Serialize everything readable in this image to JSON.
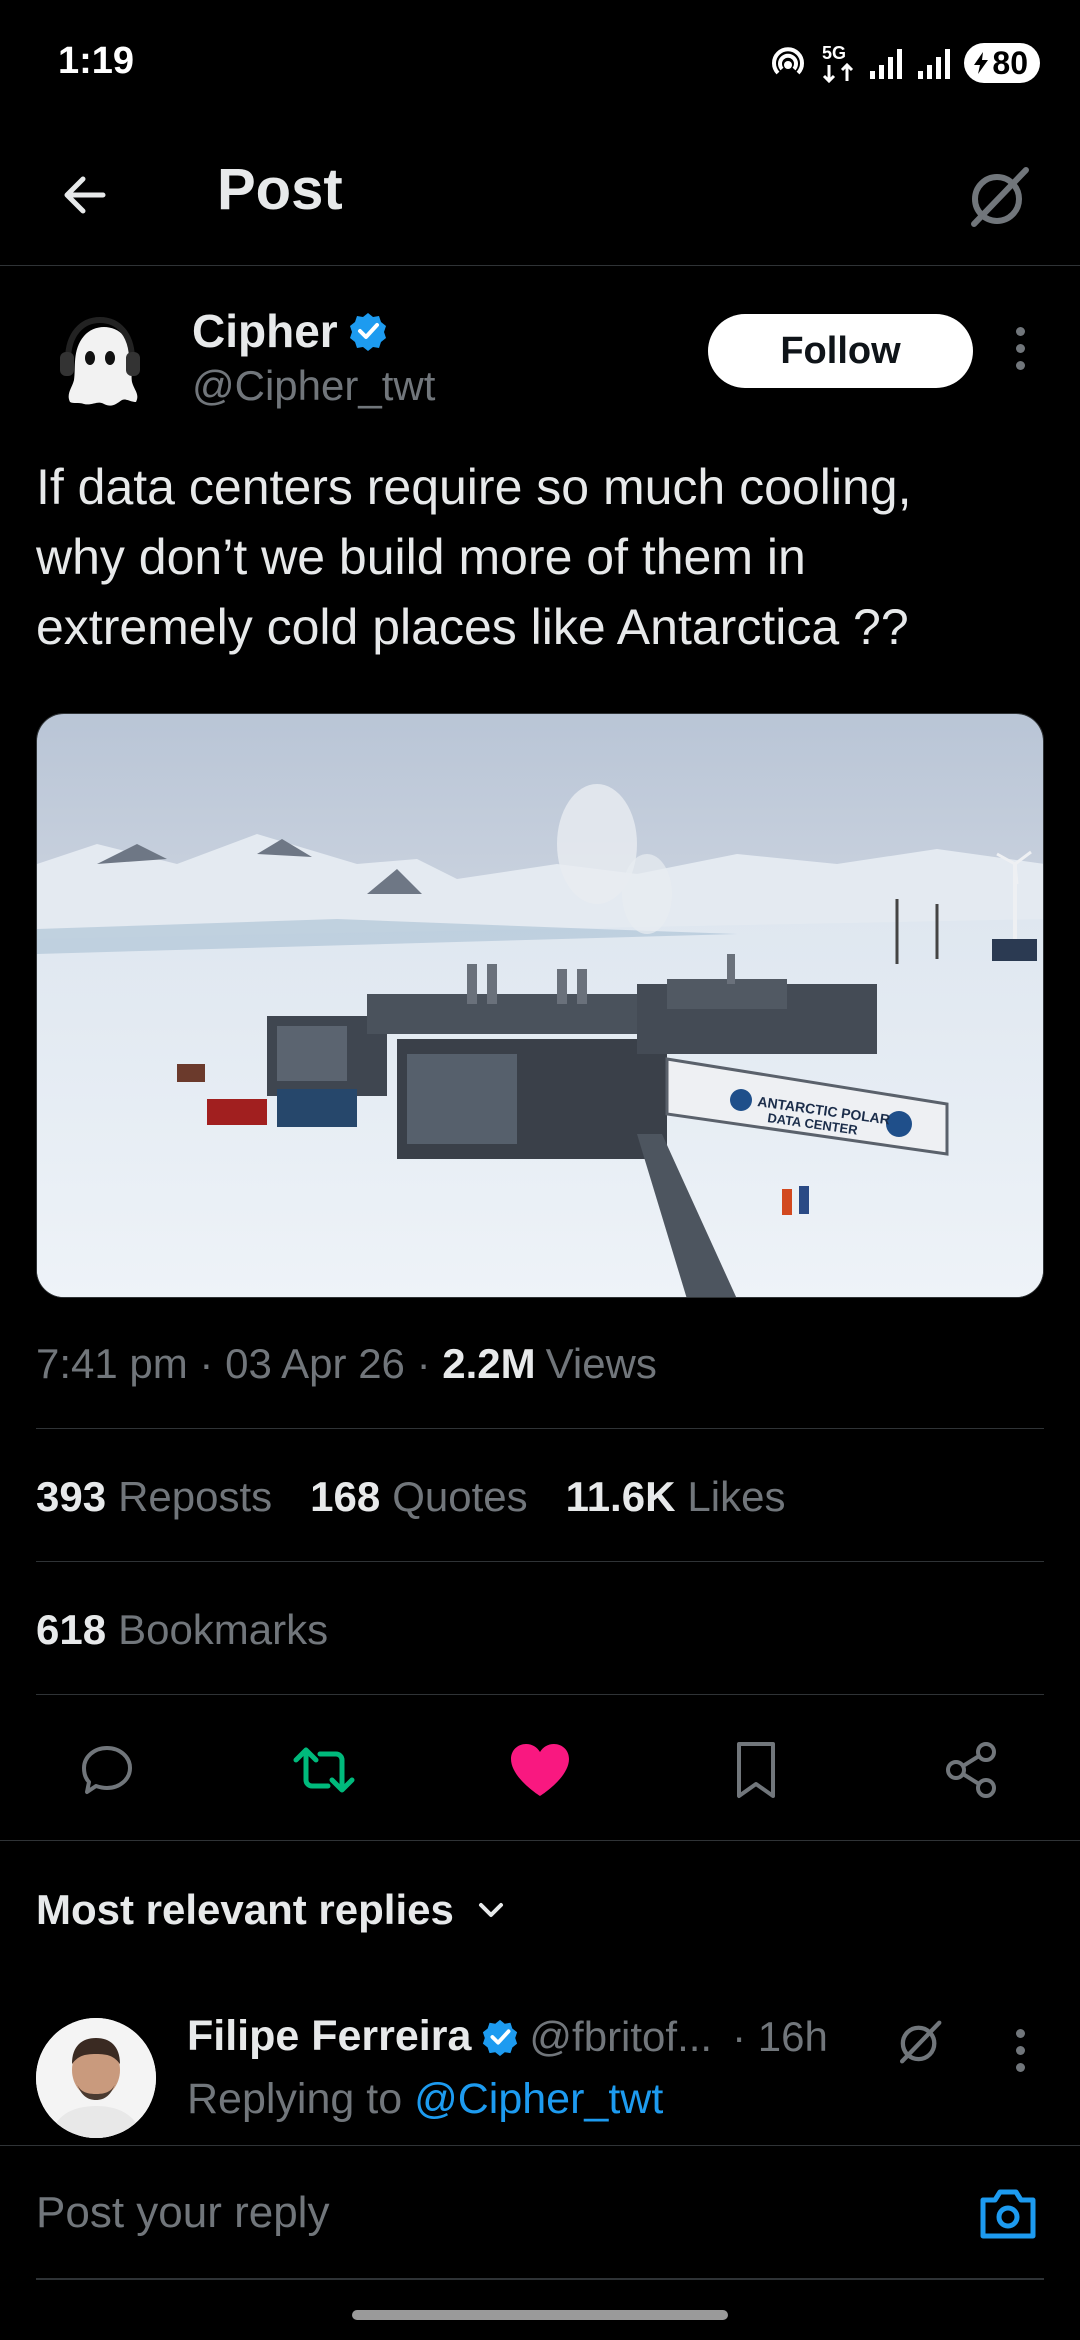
{
  "status_bar": {
    "time": "1:19",
    "network": "5G",
    "battery": "80"
  },
  "header": {
    "title": "Post"
  },
  "post": {
    "author_name": "Cipher",
    "author_handle": "@Cipher_twt",
    "follow_label": "Follow",
    "text": "If data centers require so much cooling,\nwhy don’t we build more of them in\nextremely cold places like Antarctica ??",
    "image_sign_text": [
      "ANTARCTIC POLAR",
      "DATA CENTER"
    ],
    "time": "7:41 pm",
    "date": "03 Apr 26",
    "views_count": "2.2M",
    "views_label": "Views",
    "reposts_count": "393",
    "reposts_label": "Reposts",
    "quotes_count": "168",
    "quotes_label": "Quotes",
    "likes_count": "11.6K",
    "likes_label": "Likes",
    "bookmarks_count": "618",
    "bookmarks_label": "Bookmarks",
    "separator": " · "
  },
  "actions": {
    "reply_icon": "reply-icon",
    "repost_icon": "repost-icon",
    "like_icon": "like-icon",
    "bookmark_icon": "bookmark-icon",
    "share_icon": "share-icon",
    "repost_color": "#00ba7c",
    "like_color": "#f91880"
  },
  "replies": {
    "sort_label": "Most relevant replies",
    "items": [
      {
        "name": "Filipe Ferreira",
        "handle": "@fbritof...",
        "time": "· 16h",
        "replying_prefix": "Replying to",
        "replying_to": "@Cipher_twt"
      }
    ]
  },
  "composer": {
    "placeholder": "Post your reply"
  },
  "colors": {
    "verified": "#1d9bf0",
    "link": "#1d9bf0",
    "muted": "#71767b"
  }
}
